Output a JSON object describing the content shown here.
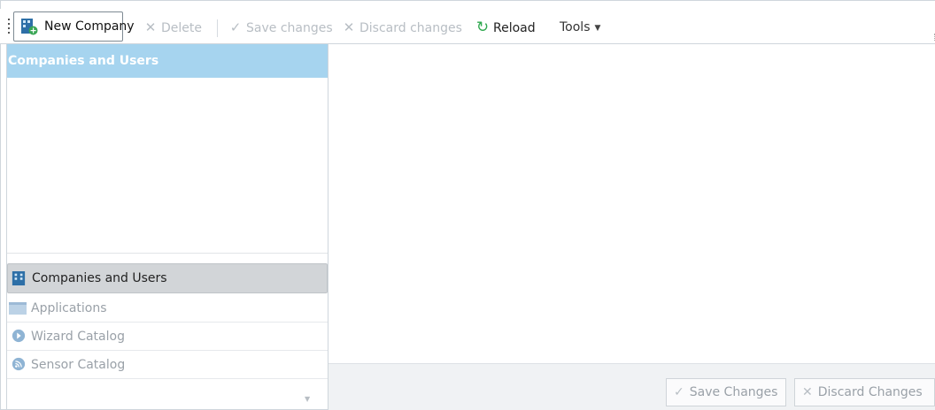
{
  "toolbar": {
    "new_company": "New Company",
    "delete": "Delete",
    "save_changes": "Save changes",
    "discard_changes": "Discard changes",
    "reload": "Reload",
    "tools": "Tools"
  },
  "left_panel": {
    "header": "Companies and Users",
    "nav": [
      {
        "label": "Companies and Users",
        "icon": "companies-icon",
        "selected": true
      },
      {
        "label": "Applications",
        "icon": "applications-icon",
        "selected": false
      },
      {
        "label": "Wizard Catalog",
        "icon": "wizard-icon",
        "selected": false
      },
      {
        "label": "Sensor Catalog",
        "icon": "sensor-icon",
        "selected": false
      }
    ]
  },
  "footer": {
    "save_changes": "Save Changes",
    "discard_changes": "Discard Changes"
  },
  "colors": {
    "header_bg": "#a6d4ef",
    "reload_green": "#2fa84f",
    "selected_nav_bg": "#d2d5d8",
    "disabled_text": "#b8bec4"
  }
}
